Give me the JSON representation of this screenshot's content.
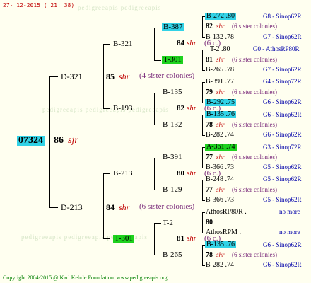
{
  "header": {
    "date": "27- 12-2015 ( 21: 38)"
  },
  "footer": {
    "copyright": "Copyright 2004-2015 @ Karl Kehrle Foundation.   www.pedigreeapis.org"
  },
  "root": {
    "code": "07324",
    "year": "86",
    "breed": "sjr"
  },
  "gen1": [
    {
      "code": "D-321",
      "year": "85",
      "breed": "shr",
      "note": "(4 sister colonies)"
    },
    {
      "code": "D-213",
      "year": "84",
      "breed": "shr",
      "note": "(6 sister colonies)"
    }
  ],
  "gen2": [
    {
      "code": "B-321"
    },
    {
      "code": "B-193"
    },
    {
      "code": "B-213"
    },
    {
      "code": "T-301"
    }
  ],
  "gen3": [
    {
      "code": "B-387",
      "year": "84",
      "breed": "shr",
      "note": "(6 c.)"
    },
    {
      "code": "T-301",
      "year": "",
      "breed": "",
      "note": ""
    },
    {
      "code": "B-135",
      "year": "82",
      "breed": "shr",
      "note": "(6 c.)"
    },
    {
      "code": "B-132",
      "year": "",
      "breed": "",
      "note": ""
    },
    {
      "code": "B-391",
      "year": "80",
      "breed": "shr",
      "note": "(6 c.)"
    },
    {
      "code": "B-129",
      "year": "",
      "breed": "",
      "note": ""
    },
    {
      "code": "T-2",
      "year": "81",
      "breed": "shr",
      "note": "(6 c.)"
    },
    {
      "code": "B-265",
      "year": "",
      "breed": "",
      "note": ""
    }
  ],
  "gen4": [
    {
      "code": "B-272 .80",
      "year": "82",
      "breed": "shr",
      "note": "(6 sister colonies)",
      "code2": "B-132 .78",
      "right1": "G8 - Sinop62R",
      "right2": "G7 - Sinop62R"
    },
    {
      "code": "T-2 .80",
      "year": "81",
      "breed": "shr",
      "note": "(6 sister colonies)",
      "code2": "B-265 .78",
      "right1": "G0 - AthosRP80R",
      "right2": "G7 - Sinop62R"
    },
    {
      "code": "B-391 .77",
      "year": "79",
      "breed": "shr",
      "note": "(6 sister colonies)",
      "code2": "B-292 .75",
      "right1": "G4 - Sinop72R",
      "right2": "G6 - Sinop62R"
    },
    {
      "code": "B-135 .76",
      "year": "78",
      "breed": "shr",
      "note": "(6 sister colonies)",
      "code2": "B-282 .74",
      "right1": "G6 - Sinop62R",
      "right2": "G6 - Sinop62R"
    },
    {
      "code": "A-361 .74",
      "year": "77",
      "breed": "shr",
      "note": "(6 sister colonies)",
      "code2": "B-366 .73",
      "right1": "G3 - Sinop72R",
      "right2": "G5 - Sinop62R"
    },
    {
      "code": "B-248 .74",
      "year": "77",
      "breed": "shr",
      "note": "(6 sister colonies)",
      "code2": "B-366 .73",
      "right1": "G5 - Sinop62R",
      "right2": "G5 - Sinop62R"
    },
    {
      "code": "AthosRP80R .",
      "year": "80",
      "breed": "",
      "note": "",
      "code2": "AthosRPM .",
      "right1": "no more",
      "right2": "no more"
    },
    {
      "code": "B-135 .76",
      "year": "78",
      "breed": "shr",
      "note": "(6 sister colonies)",
      "code2": "B-282 .74",
      "right1": "G6 - Sinop62R",
      "right2": "G6 - Sinop62R"
    }
  ]
}
